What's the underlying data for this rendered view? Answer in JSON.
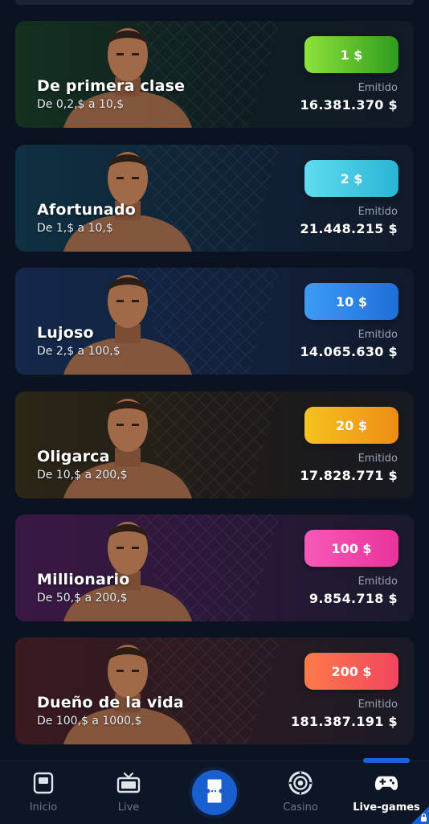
{
  "issued_label": "Emitido",
  "tickets": [
    {
      "title": "De primera clase",
      "range": "De 0,2,$ a 10,$",
      "price": "1 $",
      "issued": "16.381.370 $",
      "gradient": [
        "#8de33a",
        "#2e9c1e"
      ],
      "bg": [
        "#14301f",
        "#0f1d22",
        "#111a26"
      ]
    },
    {
      "title": "Afortunado",
      "range": "De 1,$ a 10,$",
      "price": "2 $",
      "issued": "21.448.215 $",
      "gradient": [
        "#5fdcef",
        "#2ab4d4"
      ],
      "bg": [
        "#0f3042",
        "#102235",
        "#111a2a"
      ]
    },
    {
      "title": "Lujoso",
      "range": "De 2,$ a 100,$",
      "price": "10 $",
      "issued": "14.065.630 $",
      "gradient": [
        "#3d9cf5",
        "#1e6ed8"
      ],
      "bg": [
        "#13284a",
        "#12213c",
        "#111a2c"
      ]
    },
    {
      "title": "Oligarca",
      "range": "De 10,$ a 200,$",
      "price": "20 $",
      "issued": "17.828.771 $",
      "gradient": [
        "#f4c320",
        "#ee8c14"
      ],
      "bg": [
        "#2c2616",
        "#1f1b18",
        "#171a22"
      ]
    },
    {
      "title": "Millionario",
      "range": "De 50,$ a 200,$",
      "price": "100 $",
      "issued": "9.854.718 $",
      "gradient": [
        "#f759b8",
        "#e8339b"
      ],
      "bg": [
        "#3a1844",
        "#2a1838",
        "#1a1a2c"
      ]
    },
    {
      "title": "Dueño de la vida",
      "range": "De 100,$ a 1000,$",
      "price": "200 $",
      "issued": "181.387.191 $",
      "gradient": [
        "#ff7a4a",
        "#f0455e"
      ],
      "bg": [
        "#3a1a1f",
        "#2a1a22",
        "#1b1a26"
      ]
    }
  ],
  "nav": {
    "items": [
      {
        "label": "Inicio",
        "icon": "home-icon"
      },
      {
        "label": "Live",
        "icon": "tv-icon"
      },
      {
        "label": "",
        "icon": "ticket-icon"
      },
      {
        "label": "Casino",
        "icon": "chip-icon"
      },
      {
        "label": "Live-games",
        "icon": "gamepad-icon"
      }
    ],
    "active": "Live-games",
    "accent": "#1765d8"
  }
}
